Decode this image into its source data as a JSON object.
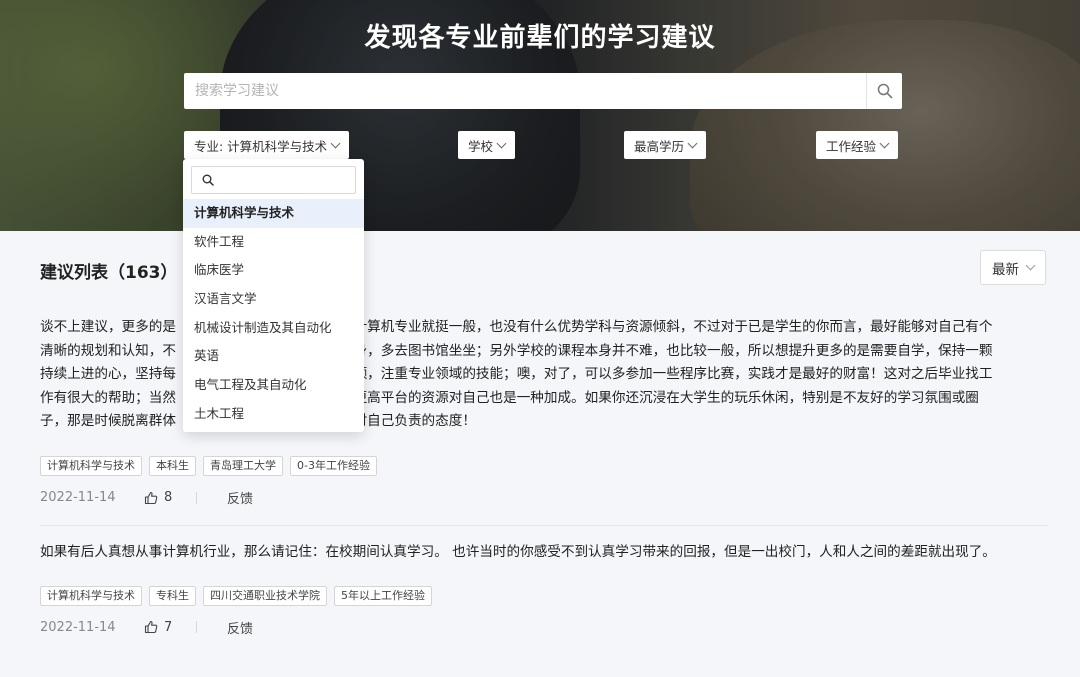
{
  "hero": {
    "title": "发现各专业前辈们的学习建议",
    "search_placeholder": "搜索学习建议"
  },
  "filters": {
    "major_label": "专业: 计算机科学与技术",
    "school_label": "学校",
    "degree_label": "最高学历",
    "experience_label": "工作经验"
  },
  "major_dropdown": {
    "selected": "计算机科学与技术",
    "options": [
      "计算机科学与技术",
      "软件工程",
      "临床医学",
      "汉语言文学",
      "机械设计制造及其自动化",
      "英语",
      "电气工程及其自动化",
      "土木工程"
    ]
  },
  "list": {
    "title": "建议列表（163）",
    "sort_label": "最新"
  },
  "advices": [
    {
      "lines": [
        "谈不上建议，更多的是",
        "清晰的规划和认知，不",
        "持续上进的心，坚持每",
        "作有很大的帮助；当然",
        "子，那是时候脱离群体"
      ],
      "lines_right": [
        "的计算机专业就挺一般，也没有什么优势学科与资源倾斜，不过对于已是学生的你而言，最好能够对自己有个",
        "自身，多去图书馆坐坐；另外学校的课程本身并不难，也比较一般，所以想提升更多的是需要自学，保持一颗",
        "视频，注重专业领域的技能；噢，对了，可以多参加一些程序比赛，实践才是最好的财富！这对之后毕业找工",
        "求更高平台的资源对自己也是一种加成。如果你还沉浸在大学生的玩乐休闲，特别是不友好的学习氛围或圈",
        "是对自己负责的态度！"
      ],
      "tags": [
        "计算机科学与技术",
        "本科生",
        "青岛理工大学",
        "0-3年工作经验"
      ],
      "date": "2022-11-14",
      "likes": "8",
      "feedback_label": "反馈"
    },
    {
      "text": "如果有后人真想从事计算机行业，那么请记住：在校期间认真学习。 也许当时的你感受不到认真学习带来的回报，但是一出校门，人和人之间的差距就出现了。",
      "tags": [
        "计算机科学与技术",
        "专科生",
        "四川交通职业技术学院",
        "5年以上工作经验"
      ],
      "date": "2022-11-14",
      "likes": "7",
      "feedback_label": "反馈"
    }
  ],
  "icons": {
    "search": "search-icon",
    "chevron": "chevron-down-icon",
    "like": "thumbs-up-icon"
  }
}
